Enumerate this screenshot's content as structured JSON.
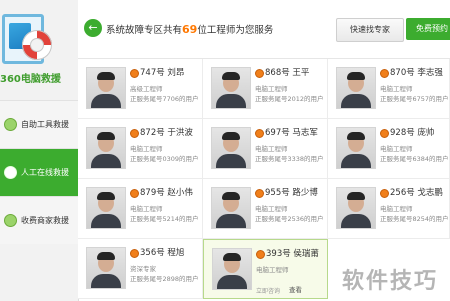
{
  "brand": {
    "name": "360电脑救援"
  },
  "sidebar": {
    "items": [
      {
        "label": "自助工具救援"
      },
      {
        "label": "人工在线救援"
      },
      {
        "label": "收费商家救援"
      }
    ]
  },
  "header": {
    "title_prefix": "系统故障专区共有",
    "count": "69",
    "title_suffix": "位工程师为您服务",
    "ask_expert_label": "快速找专家",
    "free_label": "免费预约"
  },
  "engineers": [
    {
      "name": "747号 刘昂",
      "role": "高级工程师",
      "served": "正服务尾号7706的用户"
    },
    {
      "name": "868号 王平",
      "role": "电脑工程师",
      "served": "正服务尾号2012的用户"
    },
    {
      "name": "870号 李志强",
      "role": "电脑工程师",
      "served": "正服务尾号6757的用户"
    },
    {
      "name": "872号 于洪波",
      "role": "电脑工程师",
      "served": "正服务尾号0309的用户"
    },
    {
      "name": "697号 马志军",
      "role": "电脑工程师",
      "served": "正服务尾号3338的用户"
    },
    {
      "name": "928号 庞帅",
      "role": "电脑工程师",
      "served": "正服务尾号6384的用户"
    },
    {
      "name": "879号 赵小伟",
      "role": "电脑工程师",
      "served": "正服务尾号5214的用户"
    },
    {
      "name": "955号 路少博",
      "role": "电脑工程师",
      "served": "正服务尾号2536的用户"
    },
    {
      "name": "256号 戈志鹏",
      "role": "电脑工程师",
      "served": "正服务尾号8254的用户"
    },
    {
      "name": "356号 程旭",
      "role": "资深专家",
      "served": "正服务尾号2898的用户"
    },
    {
      "name": "393号 侯瑞莆",
      "role": "电脑工程师",
      "served": "",
      "online": "立即咨询",
      "view": "查看"
    }
  ],
  "watermark": "软件技巧",
  "colors": {
    "accent": "#3cac2f",
    "count": "#ff7800"
  }
}
